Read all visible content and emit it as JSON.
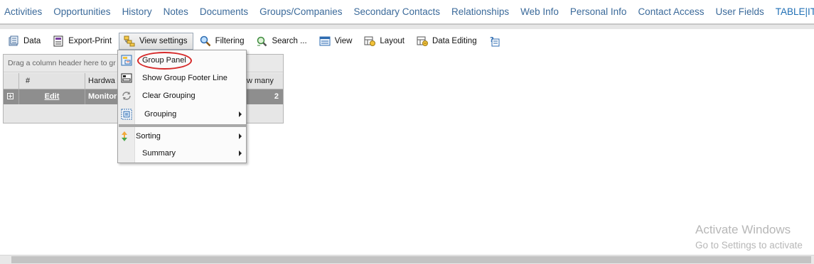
{
  "top_tabs": [
    {
      "label": "Activities"
    },
    {
      "label": "Opportunities"
    },
    {
      "label": "History"
    },
    {
      "label": "Notes"
    },
    {
      "label": "Documents"
    },
    {
      "label": "Groups/Companies"
    },
    {
      "label": "Secondary Contacts"
    },
    {
      "label": "Relationships"
    },
    {
      "label": "Web Info"
    },
    {
      "label": "Personal Info"
    },
    {
      "label": "Contact Access"
    },
    {
      "label": "User Fields"
    },
    {
      "label": "TABLE|IT"
    }
  ],
  "toolbar": {
    "data_label": "Data",
    "export_label": "Export-Print",
    "view_settings_label": "View settings",
    "filtering_label": "Filtering",
    "search_label": "Search ...",
    "view_label": "View",
    "layout_label": "Layout",
    "data_editing_label": "Data Editing"
  },
  "grid": {
    "group_panel_hint": "Drag a column header here to gr",
    "columns": [
      "#",
      "Hardwa",
      "w many"
    ],
    "row": {
      "edit": "Edit",
      "hardware": "Monitor",
      "count": "2"
    }
  },
  "view_settings_menu": {
    "items": [
      {
        "label": "Group Panel",
        "icon": "group-panel-icon"
      },
      {
        "label": "Show Group Footer Line",
        "icon": "footer-line-icon"
      },
      {
        "label": "Clear Grouping",
        "icon": "clear-grouping-icon"
      },
      {
        "label": "Grouping",
        "icon": "grouping-icon",
        "submenu": true
      },
      {
        "label": "Sorting",
        "icon": "sorting-icon",
        "submenu": true
      },
      {
        "label": "Summary",
        "icon": "",
        "submenu": true
      }
    ]
  },
  "watermark": {
    "line1": "Activate Windows",
    "line2": "Go to Settings to activate"
  },
  "colors": {
    "tab_text": "#3b6a9a",
    "grid_group_row": "#8e8e8e",
    "highlight_oval": "#d62a2a"
  }
}
